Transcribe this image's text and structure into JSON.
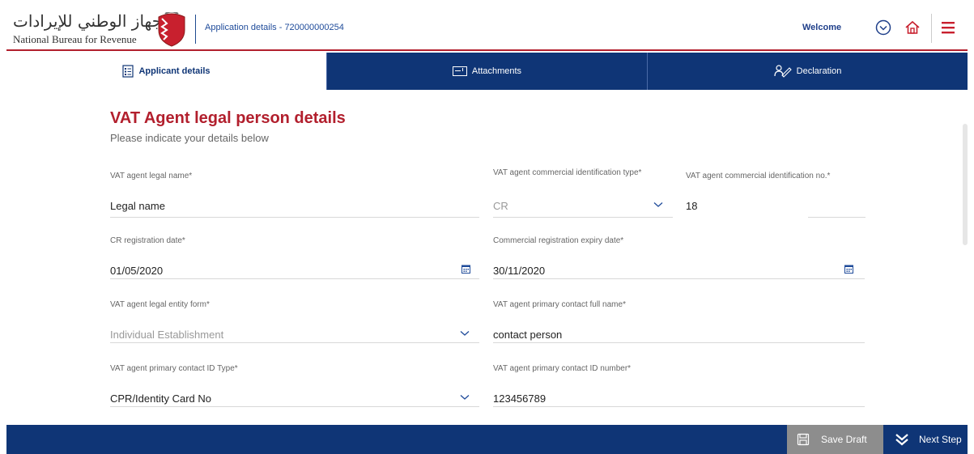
{
  "header": {
    "logo_arabic": "الجهاز الوطني للإيرادات",
    "logo_english": "National Bureau for Revenue",
    "app_title": "Application details - 720000000254",
    "welcome": "Welcome",
    "icons": [
      "chevron-circle-icon",
      "home-icon",
      "menu-icon"
    ]
  },
  "tabs": [
    {
      "label": "Applicant details",
      "icon": "form-icon",
      "active": true
    },
    {
      "label": "Attachments",
      "icon": "attachment-icon",
      "active": false
    },
    {
      "label": "Declaration",
      "icon": "signature-icon",
      "active": false
    }
  ],
  "form": {
    "title": "VAT Agent legal person details",
    "subtitle": "Please indicate your details below",
    "fields": {
      "legal_name": {
        "label": "VAT agent legal name*",
        "value": "Legal name"
      },
      "id_type": {
        "label": "VAT agent commercial identification type*",
        "value": "CR"
      },
      "id_no": {
        "label": "VAT agent commercial identification no.*",
        "value": "18"
      },
      "cr_reg_date": {
        "label": "CR registration date*",
        "value": "01/05/2020"
      },
      "cr_expiry_date": {
        "label": "Commercial registration expiry date*",
        "value": "30/11/2020"
      },
      "entity_form": {
        "label": "VAT agent legal entity form*",
        "value": "Individual Establishment"
      },
      "contact_name": {
        "label": "VAT agent primary contact full name*",
        "value": "contact person"
      },
      "contact_id_type": {
        "label": "VAT agent primary contact ID Type*",
        "value": "CPR/Identity Card No"
      },
      "contact_id_number": {
        "label": "VAT agent primary contact ID number*",
        "value": "123456789"
      }
    }
  },
  "footer": {
    "save_draft": "Save Draft",
    "next_step": "Next Step"
  },
  "colors": {
    "brand_blue": "#0f3576",
    "brand_red": "#b21f2d",
    "save_grey": "#8d8d8d"
  }
}
